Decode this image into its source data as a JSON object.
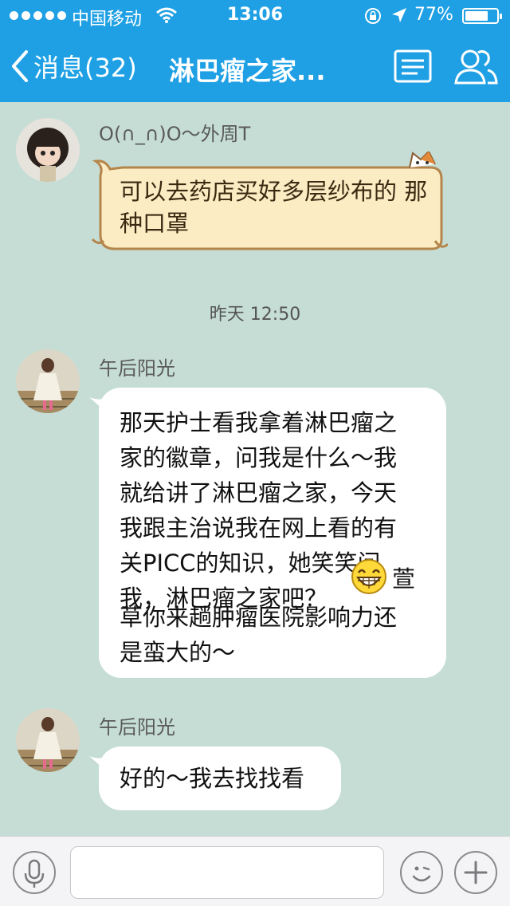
{
  "status_bar": {
    "carrier": "中国移动",
    "time": "13:06",
    "battery_percent": "77%",
    "battery_level": 0.77,
    "icons": [
      "signal-dots-icon",
      "wifi-icon",
      "rotation-lock-icon",
      "location-arrow-icon",
      "battery-icon"
    ]
  },
  "nav": {
    "back_label": "消息(32)",
    "title": "淋巴瘤之家...",
    "icons": [
      "back-chevron-icon",
      "menu-list-icon",
      "contacts-icon"
    ]
  },
  "messages": [
    {
      "sender": "O(∩_∩)O～外周T",
      "text": "可以去药店买好多层纱布的\n那种口罩",
      "bubble_style": "cat-theme"
    },
    {
      "timestamp": "昨天 12:50"
    },
    {
      "sender": "午后阳光",
      "text_before_emoji": "那天护士看我拿着淋巴瘤之\n家的徽章，问我是什么～我\n就给讲了淋巴瘤之家，今天\n我跟主治说我在网上看的有\n关PICC的知识，她笑笑问\n我，淋巴瘤之家吧？",
      "emoji": "grinning-emoji-icon",
      "text_after_emoji": "萱",
      "text_tail": "草你来趟肿瘤医院影响力还\n是蛮大的～"
    },
    {
      "sender": "午后阳光",
      "text": "好的～我去找找看"
    }
  ],
  "composer": {
    "input_value": "",
    "icons": [
      "microphone-icon",
      "emoji-face-icon",
      "plus-icon"
    ]
  },
  "colors": {
    "nav_bg": "#1fa0e4",
    "chat_bg": "#c5ddd5",
    "cat_bubble_bg": "#fbecc3",
    "cat_bubble_border": "#b5864c"
  }
}
